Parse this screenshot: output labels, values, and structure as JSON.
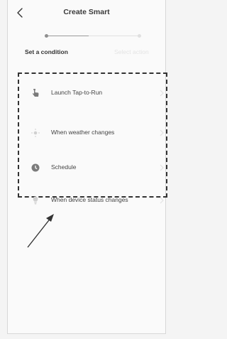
{
  "header": {
    "title": "Create Smart"
  },
  "steps": {
    "active_label": "Set a condition",
    "inactive_label": "Select action"
  },
  "progress": {
    "fraction": 0.45
  },
  "options": [
    {
      "label": "Launch Tap-to-Run",
      "icon": "tap-icon"
    },
    {
      "label": "When weather changes",
      "icon": "weather-icon"
    },
    {
      "label": "Schedule",
      "icon": "clock-icon"
    },
    {
      "label": "When device status changes",
      "icon": "device-icon"
    }
  ],
  "colors": {
    "dashed_border": "#333333",
    "progress_fill": "#9b9b9b",
    "icon_gray": "#7b7b7b"
  }
}
